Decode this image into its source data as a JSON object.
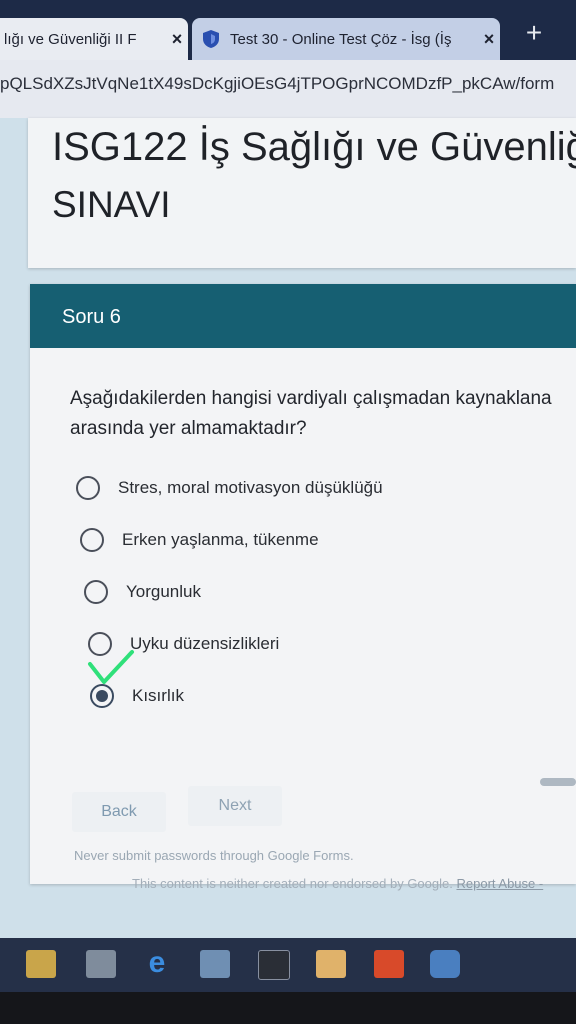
{
  "browser": {
    "tabs": [
      {
        "title": "lığı ve Güvenliği II F",
        "active": true
      },
      {
        "title": "Test 30 - Online Test Çöz - İsg (İş",
        "active": false
      }
    ],
    "new_tab": "+",
    "close": "×",
    "url": "pQLSdXZsJtVqNe1tX49sDcKgjiOEsG4jTPOGprNCOMDzfP_pkCAw/form"
  },
  "form": {
    "title_line1": "ISG122 İş Sağlığı ve Güvenliğ",
    "title_line2": "SINAVI",
    "section": "Soru 6",
    "question_line1": "Aşağıdakilerden hangisi vardiyalı çalışmadan kaynaklana",
    "question_line2": "arasında yer almamaktadır?",
    "options": [
      {
        "label": "Stres, moral motivasyon düşüklüğü",
        "selected": false
      },
      {
        "label": "Erken yaşlanma, tükenme",
        "selected": false
      },
      {
        "label": "Yorgunluk",
        "selected": false
      },
      {
        "label": "Uyku düzensizlikleri",
        "selected": false
      },
      {
        "label": "Kısırlık",
        "selected": true
      }
    ],
    "back_label": "Back",
    "next_label": "Next",
    "footer_warning": "Never submit passwords through Google Forms.",
    "footer_disclaimer": "This content is neither created nor endorsed by Google.",
    "footer_link": "Report Abuse -"
  },
  "colors": {
    "header": "#165f72",
    "checkmark": "#2fe07a"
  }
}
